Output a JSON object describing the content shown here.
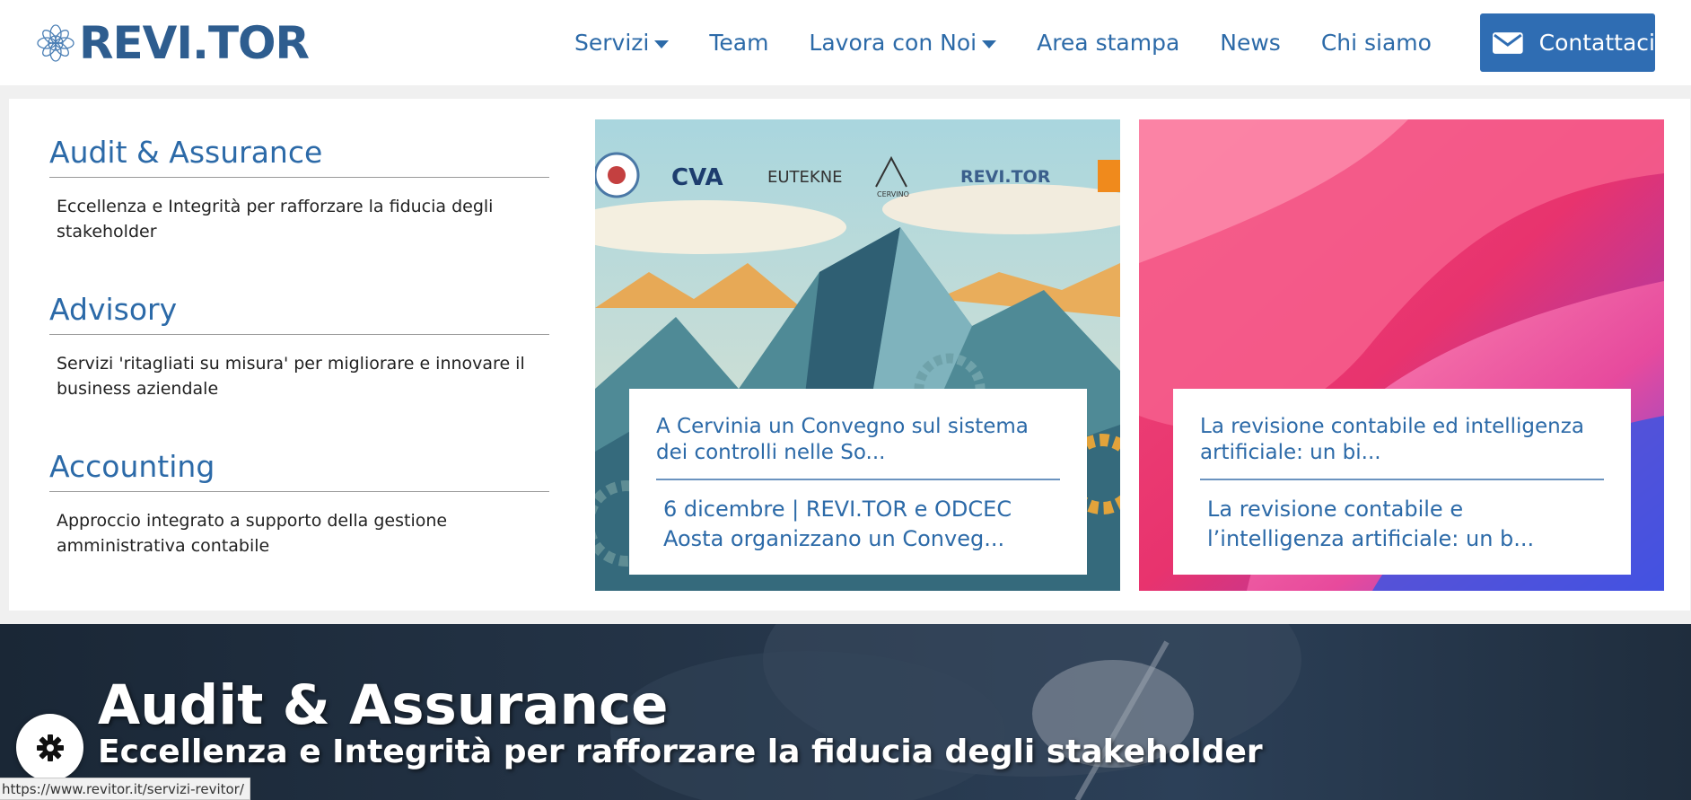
{
  "header": {
    "logo_text": "REVI.TOR",
    "nav": [
      {
        "label": "Servizi",
        "dropdown": true
      },
      {
        "label": "Team",
        "dropdown": false
      },
      {
        "label": "Lavora con Noi",
        "dropdown": true
      },
      {
        "label": "Area stampa",
        "dropdown": false
      },
      {
        "label": "News",
        "dropdown": false
      },
      {
        "label": "Chi siamo",
        "dropdown": false
      }
    ],
    "contact_label": "Contattaci"
  },
  "mega_menu": {
    "services": [
      {
        "title": "Audit & Assurance",
        "description": "Eccellenza e Integrità per rafforzare la fiducia degli stakeholder"
      },
      {
        "title": "Advisory",
        "description": "Servizi 'ritagliati su misura' per migliorare e innovare il business aziendale"
      },
      {
        "title": "Accounting",
        "description": "Approccio integrato a supporto della gestione amministrativa contabile"
      }
    ],
    "news_cards": [
      {
        "title": "A Cervinia un Convegno sul sistema dei controlli nelle So...",
        "excerpt": "6 dicembre | REVI.TOR e ODCEC Aosta organizzano un Conveg...",
        "image_logos": [
          "CVA",
          "EUTEKNE",
          "CERVINO",
          "REVI.TOR"
        ]
      },
      {
        "title": "La revisione contabile ed intelligenza artificiale: un bi...",
        "excerpt": "La revisione contabile e l’intelligenza artificiale: un b..."
      }
    ]
  },
  "hero": {
    "title": "Audit & Assurance",
    "subtitle": "Eccellenza e Integrità per rafforzare la fiducia degli stakeholder"
  },
  "status_bar": {
    "url": "https://www.revitor.it/servizi-revitor/"
  },
  "colors": {
    "brand_blue": "#2c6aa8",
    "button_blue": "#2f6db3",
    "logo_blue": "#2e5d8f"
  },
  "icons": {
    "contact": "envelope-icon",
    "cookie": "gear-icon",
    "nav_dropdown": "caret-down-icon"
  }
}
